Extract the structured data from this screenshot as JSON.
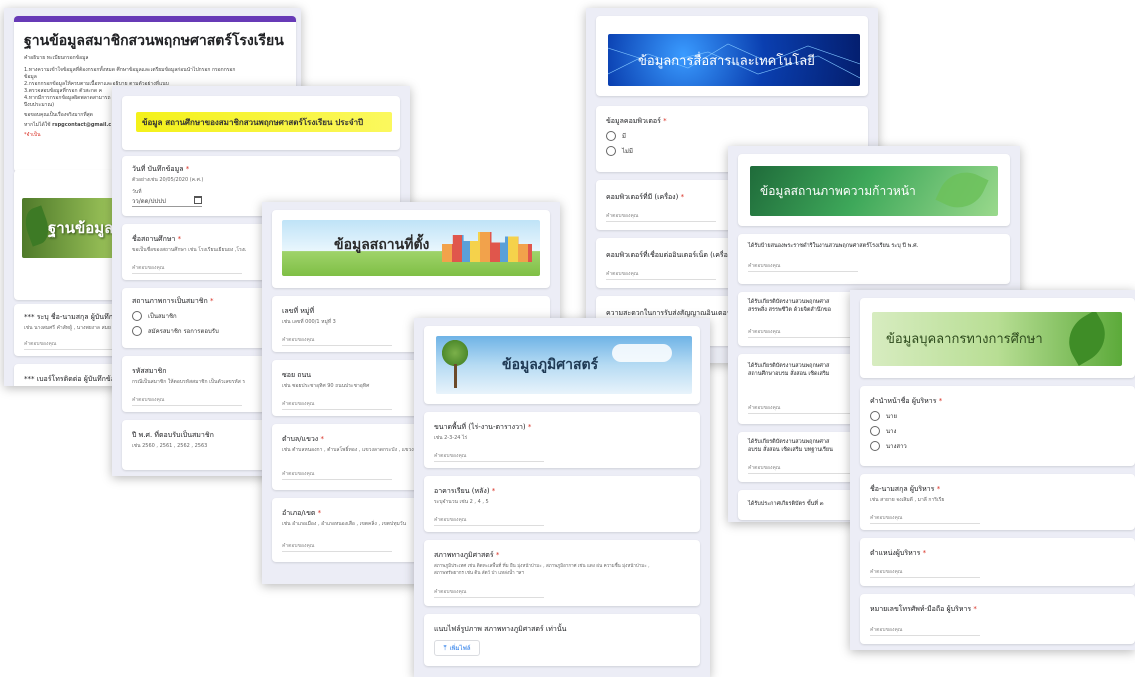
{
  "form1": {
    "title": "ฐานข้อมูลสมาชิกสวนพฤกษศาสตร์โรงเรียน",
    "subtitle": "คำอธิบาย ทะเบียนกรอกข้อมูล",
    "desc_lines": [
      "1.ทางความเข้าใจข้อมูลที่ต้องกรอกทั้งหมด  ศึกษาข้อมูลและเตรียมข้อมูลก่อนนำไปกรอก กรอกกรอก",
      "ข้อมูล",
      "2.กรอกกรอกข้อมูลให้ครบตามเนื้อหาและอธิบาย ตามตัวอย่างที่แนบ",
      "3.ตรวจสอบข้อมูลที่กรอก ตัวสะกด ค",
      "4.หากมีการกรอกข้อมูลผิดพลาดสามารถ",
      "ปีงบประมาณ)",
      "ขอขอบคุณเป็นเรื่องจริงมากที่สุด"
    ],
    "contact_prefix": "หากไม่ได้ใช้ ",
    "contact_email": "rspgcontact@gmail.c",
    "required_note": "*จำเป็น",
    "banner_title": "ฐานข้อมูลสมา",
    "q1_title": "*** ระบุ ชื่อ-นามสกุล ผู้บันทึกข้อม",
    "q1_hint": "เช่น นางสมศรี คำสัทผู้ , นางพยงาล สมย",
    "q2_title": "*** เบอร์โทรติดต่อ ผู้บันทึกข้อมูล",
    "answer_placeholder": "คำตอบของคุณ"
  },
  "form2": {
    "banner_title": "ข้อมูล สถานศึกษาของสมาชิกสวนพฤกษศาสตร์โรงเรียน ประจำปี",
    "date_title": "วันที่ บันทึกข้อมูล",
    "date_hint": "ตัวอย่างเช่น 20/05/2020 (ค.ศ.)",
    "date_label": "วันที่",
    "date_placeholder": "วว/ดด/ปปปป",
    "school_title": "ชื่อสถานศึกษา",
    "school_hint": "ขอเป็นชื่อของสถานศึกษา เช่น โรงเรียนเยียนยง ,โรงเ",
    "status_title": "สถานภาพการเป็นสมาชิก",
    "status_options": [
      "เป็นสมาชิก",
      "สมัครสมาชิก รอการตอบรับ"
    ],
    "code_title": "รหัสสมาชิก",
    "code_hint": "กรณีเป็นสมาชิก ให้ตอบรหัสสมาชิก เป็นตัวเลขรหัส ร",
    "year_title": "ปี พ.ศ. ที่ตอบรับเป็นสมาชิก",
    "year_hint": "เช่น 2560 , 2561 , 2562 , 2563",
    "answer_placeholder": "คำตอบของคุณ"
  },
  "form3": {
    "banner_title": "ข้อมูลสถานที่ตั้ง",
    "addr_title": "เลขที่ หมู่ที่",
    "addr_hint": "เช่น เลขที่ 000/1 หมู่ที่ 3",
    "soi_title": "ซอย ถนน",
    "soi_hint": "เช่น ซอยประชาอุทิศ 90 ถนนประชาอุทิศ",
    "subdistrict_title": "ตำบล/แขวง",
    "subdistrict_hint": "เช่น ตำบลหนองกา , ตำบลโพธิ์ทอง , แขวงลาดกระบัง , แขวงวัด",
    "district_title": "อำเภอ/เขต",
    "district_hint": "เช่น อำเภอเมือง , อำเภอหนองเสือ , เขตคลิ่ง , เขตปทุมวัน",
    "answer_placeholder": "คำตอบของคุณ"
  },
  "form4": {
    "banner_title": "ข้อมูลการสื่อสารและเทคโนโลยี",
    "computer_title": "ข้อมูลคอมพิวเตอร์",
    "computer_options": [
      "มี",
      "ไม่มี"
    ],
    "count_title": "คอมพิวเตอร์ที่มี (เครื่อง)",
    "internet_title": "คอมพิวเตอร์ที่เชื่อมต่ออินเตอร์เน็ต (เครื่อง)",
    "speed_title": "ความสะดวกในการรับส่งสัญญาณอินเตอร์เน็",
    "answer_placeholder": "คำตอบของคุณ"
  },
  "form5": {
    "banner_title": "ข้อมูลภูมิศาสตร์",
    "area_title": "ขนาดพื้นที่ (ไร่-งาน-ตารางวา)",
    "area_hint": "เช่น 2-3-24 ไร่",
    "building_title": "อาคารเรียน (หลัง)",
    "building_hint": "ระบุจำนวน เช่น 2 , 4 , 5",
    "geo_title": "สภาพทางภูมิศาสตร์",
    "geo_hint_1": "สภาพภูมิประเทศ เช่น ติดทะเลพื้นที่ ที่ม ยืน มุ่งหน้าป่ามะ , สภาพภูมิอากาศ เช่น แดง ฝน ความชื้น มุ่งหน้าป่ามะ ,",
    "geo_hint_2": "สภาพทรัพยากร เช่น ดิน สัตว์ ป่า แหล่งน้ำ ฯลฯ",
    "upload_title": "แนบไฟล์รูปภาพ สภาพทางภูมิศาสตร์ เท่านั้น",
    "upload_button": "เพิ่มไฟล์",
    "answer_placeholder": "คำตอบของคุณ"
  },
  "form6": {
    "banner_title": "ข้อมูลสถานภาพความก้าวหน้า",
    "q1_title": "ได้รับป้ายสนองพระราชดำริในงานสวนพฤกษศาสตร์โรงเรียน ระบุ ปี พ.ศ.",
    "q2_title_1": "ได้รับเกียรติบัตรงานสวนพฤกษศาส",
    "q2_title_2": "สรรพสิ่ง สรรพชีวิต ด้วยจิตสำนึกขอ",
    "q3_title_1": "ได้รับเกียรติบัตรงานสวนพฤกษศาส",
    "q3_title_2": "สถานศึกษาอบรม สั่งสอน เชิดเสริม",
    "q4_title_1": "ได้รับเกียรติบัตรงานสวนพฤกษศาส",
    "q4_title_2": "อบรม สั่งสอน เชิดเสริม บทฐานเรียน",
    "q5_title": "ได้รับประกาศเกียรติบัตร ขั้นที่ ๓",
    "answer_placeholder": "คำตอบของคุณ"
  },
  "form7": {
    "banner_title": "ข้อมูลบุคลากรทางการศึกษา",
    "prefix_title": "คำนำหน้าชื่อ ผู้บริหาร",
    "prefix_options": [
      "นาย",
      "นาง",
      "นางสาว"
    ],
    "name_title": "ชื่อ-นามสกุล ผู้บริหาร",
    "name_hint": "เช่น สายาย จงเสิมดี , มาลี การิเรีย",
    "position_title": "ตำแหน่งผู้บริหาร",
    "phone_title": "หมายเลขโทรศัพท์-มือถือ ผู้บริหาร",
    "answer_placeholder": "คำตอบของคุณ"
  },
  "colors": {
    "accent_purple": "#673ab7",
    "required_red": "#d93025",
    "yellow_highlight": "#f4f11a",
    "upload_blue": "#1a73e8"
  }
}
